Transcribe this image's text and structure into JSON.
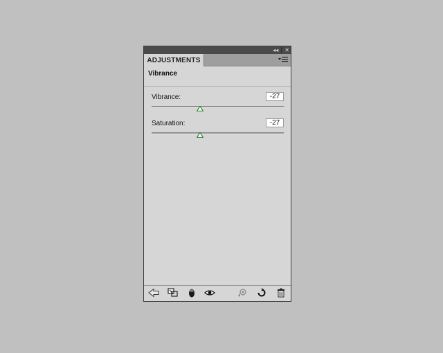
{
  "panel": {
    "tab_label": "ADJUSTMENTS",
    "section_title": "Vibrance",
    "titlebar_icons": [
      "collapse-icon",
      "close-icon"
    ],
    "menu_icon": "panel-menu-icon"
  },
  "sliders": [
    {
      "label": "Vibrance:",
      "value": "-27",
      "level": -27,
      "min": -100,
      "max": 100
    },
    {
      "label": "Saturation:",
      "value": "-27",
      "level": -27,
      "min": -100,
      "max": 100
    }
  ],
  "footer_icons": [
    "back-arrow-icon",
    "clip-to-layer-icon",
    "layer-mask-icon",
    "visibility-eye-icon",
    "view-previous-state-icon",
    "reset-icon",
    "delete-trash-icon"
  ],
  "colors": {
    "background": "#c0c0c0",
    "panel": "#d6d6d6",
    "titlebar": "#4a4a4a",
    "thumb_accent": "#2f8a2f"
  }
}
